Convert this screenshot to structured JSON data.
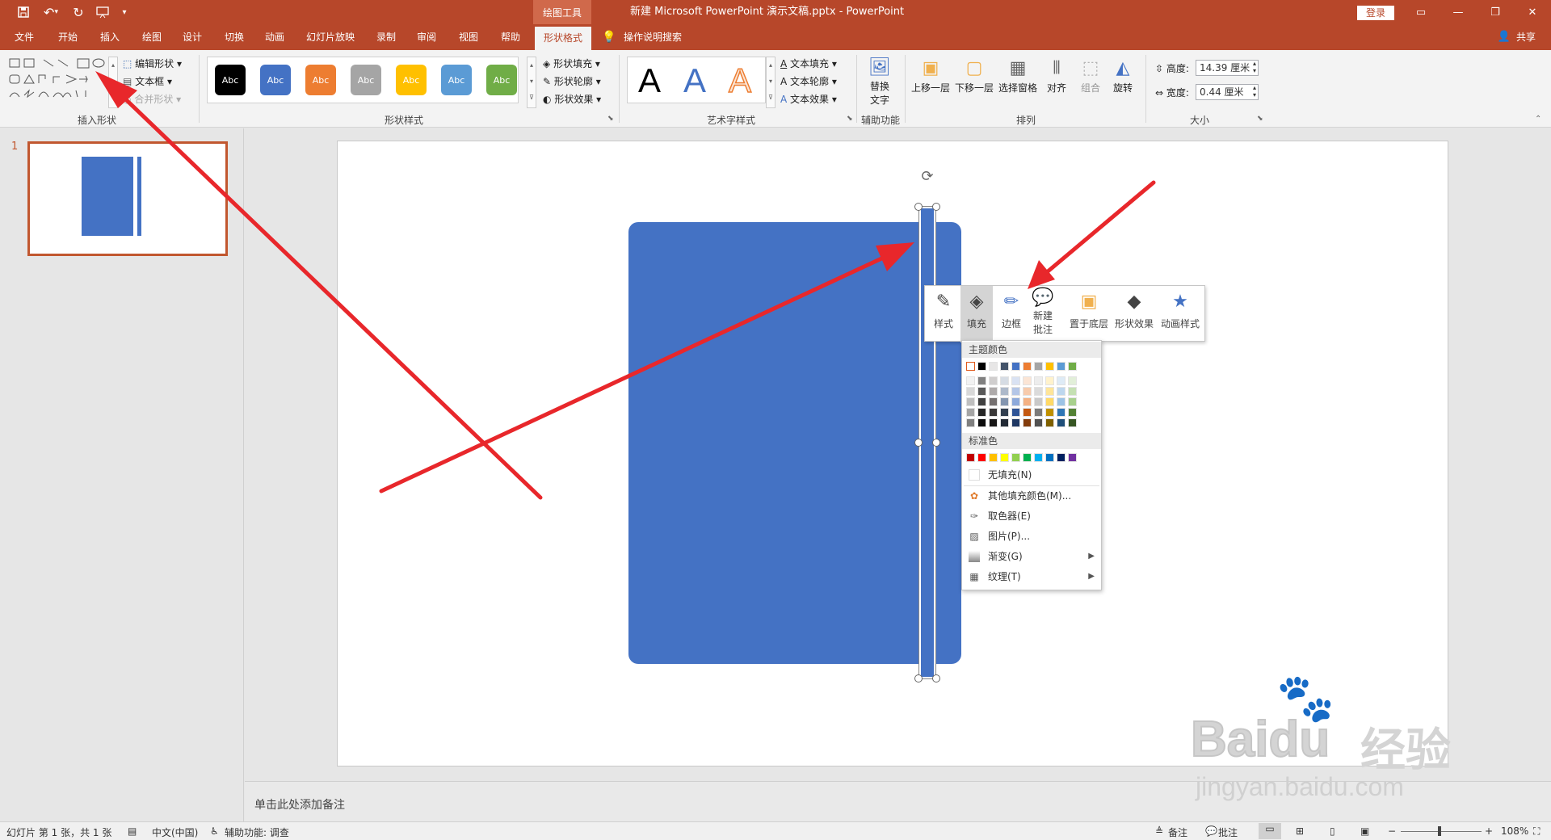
{
  "titlebar": {
    "context_tab": "绘图工具",
    "title": "新建 Microsoft PowerPoint 演示文稿.pptx  -  PowerPoint",
    "login": "登录",
    "quick_access_icons": [
      "save-icon",
      "undo-icon",
      "redo-icon",
      "slideshow-from-start-icon",
      "customize-toolbar-icon"
    ]
  },
  "tabs": [
    "文件",
    "开始",
    "插入",
    "绘图",
    "设计",
    "切换",
    "动画",
    "幻灯片放映",
    "录制",
    "审阅",
    "视图",
    "帮助",
    "形状格式"
  ],
  "active_tab": "形状格式",
  "tell_me": "操作说明搜索",
  "share": "共享",
  "ribbon": {
    "insert_shapes": {
      "label": "插入形状",
      "edit_shape": "编辑形状",
      "text_box": "文本框",
      "merge_shapes": "合并形状"
    },
    "shape_styles": {
      "label": "形状样式",
      "swatch_text": "Abc",
      "swatches": [
        "#000000",
        "#4472c4",
        "#ed7d31",
        "#a5a5a5",
        "#ffc000",
        "#5b9bd5",
        "#70ad47"
      ],
      "fill": "形状填充",
      "outline": "形状轮廓",
      "effects": "形状效果"
    },
    "wordart": {
      "label": "艺术字样式",
      "letter": "A",
      "text_fill": "文本填充",
      "text_outline": "文本轮廓",
      "text_effects": "文本效果"
    },
    "accessibility": {
      "label": "辅助功能",
      "alt_text_1": "替换",
      "alt_text_2": "文字"
    },
    "arrange": {
      "label": "排列",
      "bring_forward": "上移一层",
      "send_backward": "下移一层",
      "selection_pane": "选择窗格",
      "align": "对齐",
      "group": "组合",
      "rotate": "旋转"
    },
    "size": {
      "label": "大小",
      "height_label": "高度:",
      "height_value": "14.39 厘米",
      "width_label": "宽度:",
      "width_value": "0.44 厘米"
    }
  },
  "slide_number": "1",
  "colors": {
    "shape_blue": "#4472c4",
    "accent": "#b7472a",
    "arrow_red": "#e8272b"
  },
  "mini_toolbar": {
    "style": "样式",
    "fill": "填充",
    "border": "边框",
    "new_comment_1": "新建",
    "new_comment_2": "批注",
    "send_to_back": "置于底层",
    "shape_effects": "形状效果",
    "animation_styles": "动画样式"
  },
  "fill_menu": {
    "theme_colors": "主题颜色",
    "theme_top": [
      "#ffffff",
      "#000000",
      "#e7e6e6",
      "#44546a",
      "#4472c4",
      "#ed7d31",
      "#a5a5a5",
      "#ffc000",
      "#5b9bd5",
      "#70ad47"
    ],
    "theme_shades": [
      [
        "#f2f2f2",
        "#808080",
        "#d0cece",
        "#d6dce4",
        "#d9e2f3",
        "#fbe5d5",
        "#ededed",
        "#fff2cc",
        "#deebf6",
        "#e2efd9"
      ],
      [
        "#d8d8d8",
        "#595959",
        "#aeaaaa",
        "#adb9ca",
        "#b4c6e7",
        "#f7cbac",
        "#dbdbdb",
        "#fee599",
        "#bdd7ee",
        "#c5e0b3"
      ],
      [
        "#bfbfbf",
        "#404040",
        "#757070",
        "#8496b0",
        "#8eaadb",
        "#f4b183",
        "#c9c9c9",
        "#ffd966",
        "#9cc3e5",
        "#a8d08d"
      ],
      [
        "#a5a5a5",
        "#262626",
        "#3a3838",
        "#323f4f",
        "#2f5496",
        "#c45911",
        "#7b7b7b",
        "#bf9000",
        "#2e75b5",
        "#538135"
      ],
      [
        "#7f7f7f",
        "#0d0d0d",
        "#171616",
        "#222a35",
        "#1f3864",
        "#833c0b",
        "#525252",
        "#7f6000",
        "#1f4e79",
        "#375623"
      ]
    ],
    "standard_colors": "标准色",
    "standard": [
      "#c00000",
      "#ff0000",
      "#ffc000",
      "#ffff00",
      "#92d050",
      "#00b050",
      "#00b0f0",
      "#0070c0",
      "#002060",
      "#7030a0"
    ],
    "no_fill": "无填充(N)",
    "more_colors": "其他填充颜色(M)...",
    "eyedropper": "取色器(E)",
    "picture": "图片(P)...",
    "gradient": "渐变(G)",
    "texture": "纹理(T)"
  },
  "notes_placeholder": "单击此处添加备注",
  "status": {
    "slide_info": "幻灯片 第 1 张，共 1 张",
    "language": "中文(中国)",
    "accessibility": "辅助功能: 调查",
    "notes": "备注",
    "comments": "批注",
    "zoom": "108%"
  },
  "watermark": {
    "brand": "Baidu",
    "brand_cn": "经验",
    "url": "jingyan.baidu.com"
  }
}
